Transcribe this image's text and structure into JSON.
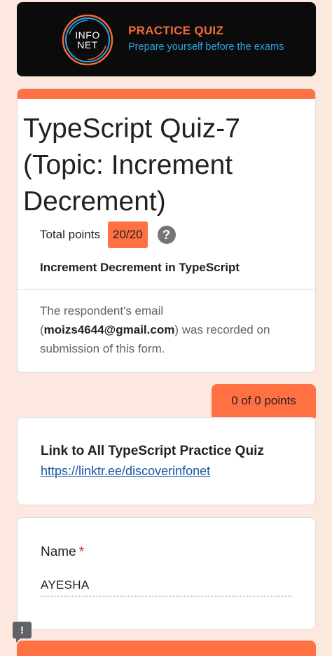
{
  "banner": {
    "logo_line1": "INFO",
    "logo_line2": "NET",
    "title": "PRACTICE QUIZ",
    "subtitle": "Prepare yourself before the exams"
  },
  "form": {
    "title": "TypeScript Quiz-7 (Topic:  Increment Decrement)",
    "points_label": "Total points",
    "points_value": "20/20",
    "description": "Increment Decrement in TypeScript",
    "email_prefix": "The respondent's email (",
    "email": "moizs4644@gmail.com",
    "email_suffix": ") was recorded on submission of this form."
  },
  "section_link": {
    "score": "0 of 0 points",
    "title": "Link to All TypeScript Practice Quiz",
    "url": "https://linktr.ee/discoverinfonet"
  },
  "name_question": {
    "label": "Name",
    "required_marker": "*",
    "answer": "AYESHA"
  },
  "icons": {
    "help": "question-mark-circle-icon",
    "report": "report-problem-icon"
  },
  "colors": {
    "accent": "#ff7043",
    "background": "#fde8df",
    "link": "#1a56a8",
    "banner_title": "#f26b3a",
    "banner_subtitle": "#2ea3e6"
  }
}
